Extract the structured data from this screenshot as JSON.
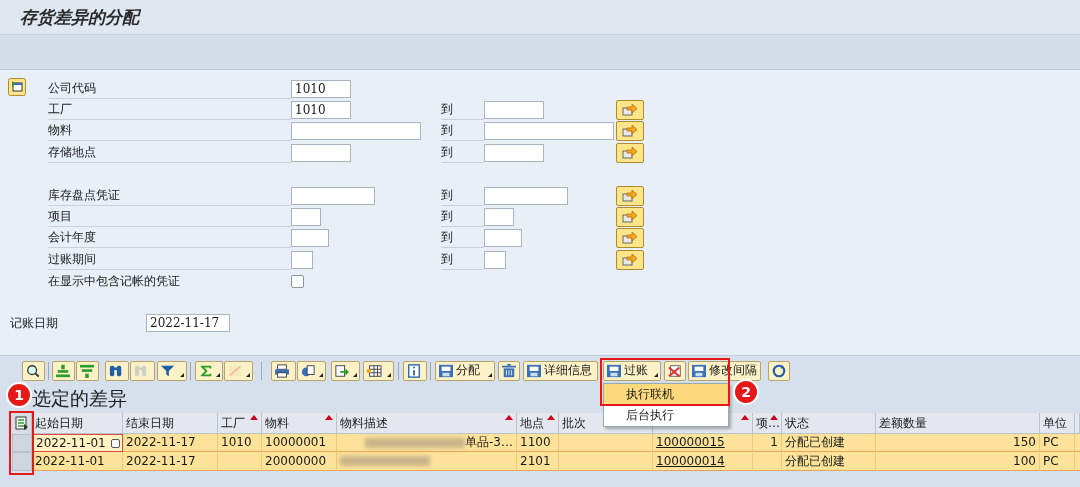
{
  "window": {
    "title": "存货差异的分配"
  },
  "selection": {
    "fields": [
      {
        "label": "公司代码",
        "value": "1010",
        "kind": "single"
      },
      {
        "label": "工厂",
        "value": "1010",
        "kind": "range",
        "to_label": "到"
      },
      {
        "label": "物料",
        "kind": "range",
        "to_label": "到"
      },
      {
        "label": "存储地点",
        "kind": "range",
        "to_label": "到"
      },
      {
        "kind": "gap"
      },
      {
        "label": "库存盘点凭证",
        "kind": "range",
        "to_label": "到"
      },
      {
        "label": "项目",
        "kind": "range",
        "to_label": "到"
      },
      {
        "label": "会计年度",
        "kind": "range",
        "to_label": "到"
      },
      {
        "label": "过账期间",
        "kind": "range",
        "to_label": "到"
      }
    ],
    "checkbox": {
      "label": "在显示中包含记帐的凭证",
      "checked": false
    },
    "posting_date": {
      "label": "记账日期",
      "value": "2022-11-17"
    }
  },
  "toolbar": [
    {
      "kind": "icon",
      "dropdown": false,
      "disabled": false
    },
    {
      "kind": "separator"
    },
    {
      "kind": "icon",
      "dropdown": false,
      "disabled": false
    },
    {
      "kind": "icon",
      "dropdown": false,
      "disabled": false
    },
    {
      "kind": "icon",
      "dropdown": false,
      "disabled": false
    },
    {
      "kind": "icon",
      "dropdown": false,
      "disabled": true
    },
    {
      "kind": "icon",
      "dropdown": true,
      "disabled": false
    },
    {
      "kind": "separator"
    },
    {
      "kind": "icon",
      "dropdown": true,
      "disabled": false
    },
    {
      "kind": "icon",
      "dropdown": true,
      "disabled": true
    },
    {
      "kind": "separator"
    },
    {
      "kind": "icon",
      "dropdown": false,
      "disabled": false
    },
    {
      "kind": "icon",
      "dropdown": true,
      "disabled": false
    },
    {
      "kind": "icon",
      "dropdown": true,
      "disabled": false
    },
    {
      "kind": "icon",
      "dropdown": true,
      "disabled": false
    },
    {
      "kind": "separator"
    },
    {
      "kind": "icon",
      "dropdown": false,
      "disabled": false
    },
    {
      "kind": "separator"
    },
    {
      "kind": "text",
      "label": "分配",
      "dropdown": true,
      "disabled": false
    },
    {
      "kind": "icon",
      "dropdown": false,
      "disabled": false
    },
    {
      "kind": "text",
      "label": "详细信息",
      "dropdown": false,
      "disabled": false
    },
    {
      "kind": "text",
      "label": "过账",
      "dropdown": true,
      "disabled": false
    },
    {
      "kind": "icon",
      "dropdown": false,
      "disabled": false
    },
    {
      "kind": "text",
      "label": "修改间隔",
      "dropdown": false,
      "disabled": false
    },
    {
      "kind": "icon",
      "dropdown": false,
      "disabled": false
    }
  ],
  "menu": {
    "items": [
      {
        "label": "执行联机",
        "selected": true
      },
      {
        "label": "后台执行",
        "selected": false
      }
    ]
  },
  "table": {
    "title": "选定的差异",
    "columns": [
      {
        "label": "起始日期",
        "sorted": false
      },
      {
        "label": "结束日期",
        "sorted": false
      },
      {
        "label": "工厂",
        "sorted": true
      },
      {
        "label": "物料",
        "sorted": true
      },
      {
        "label": "物料描述",
        "sorted": true
      },
      {
        "label": "地点",
        "sorted": true
      },
      {
        "label": "批次"
      },
      {
        "sorted": true
      },
      {
        "label": "项…",
        "sorted": true
      },
      {
        "label": "状态",
        "sorted": false
      },
      {
        "label": "差额数量",
        "sorted": false
      },
      {
        "label": "单位",
        "sorted": false
      }
    ],
    "rows": [
      {
        "cells": [
          "2022-11-01",
          "2022-11-17",
          "1010",
          "10000001",
          "单品-3…",
          "1100",
          "",
          "100000015",
          "1",
          "分配已创建",
          "150",
          "PC"
        ],
        "focused": true
      },
      {
        "cells": [
          "2022-11-01",
          "2022-11-17",
          "",
          "20000000",
          "",
          "2101",
          "",
          "100000014",
          "",
          "分配已创建",
          "100",
          "PC"
        ],
        "focused": false
      }
    ]
  },
  "annotations": [
    {
      "number": "1"
    },
    {
      "number": "2"
    }
  ]
}
